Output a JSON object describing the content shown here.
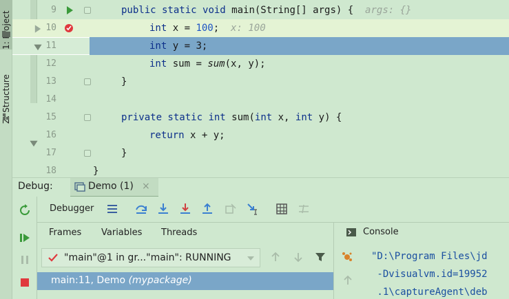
{
  "tool_strip": {
    "project_tab": "1: Project",
    "structure_tab": "Z: Structure"
  },
  "editor": {
    "lines": [
      {
        "num": "9",
        "code_parts": [
          "public",
          " static ",
          "void",
          " main(String[] args) {"
        ],
        "hint": "args: {}"
      },
      {
        "num": "10",
        "type_kw": "int",
        "rest": " x = ",
        "value": "100",
        "semicolon": ";",
        "hint": "x: 100"
      },
      {
        "num": "11",
        "type_kw": "int",
        "rest": " y = 3;"
      },
      {
        "num": "12",
        "type_kw": "int",
        "rest": " sum = ",
        "call": "sum",
        "args": "(x, y);"
      },
      {
        "num": "13",
        "code": "}"
      },
      {
        "num": "14",
        "code": ""
      },
      {
        "num": "15",
        "mods": "private static",
        "ret": "int",
        "name": " sum(",
        "p1t": "int",
        "p1": " x, ",
        "p2t": "int",
        "p2": " y) {"
      },
      {
        "num": "16",
        "kw": "return",
        "rest": " x + y;"
      },
      {
        "num": "17",
        "code": "}"
      },
      {
        "num": "18",
        "code": "}"
      }
    ]
  },
  "debug": {
    "title_label": "Debug:",
    "session_tab": "Demo (1)",
    "session_close": "×",
    "debugger_label": "Debugger",
    "tabs": [
      "Frames",
      "Variables",
      "Threads"
    ],
    "thread_selector": "\"main\"@1 in gr...\"main\": RUNNING",
    "frame": {
      "location": "main:11, Demo",
      "package": "(mypackage)"
    }
  },
  "console": {
    "tab_label": "Console",
    "output_lines": [
      "\"D:\\Program Files\\jd",
      " -Dvisualvm.id=19952",
      " .1\\captureAgent\\deb"
    ]
  },
  "colors": {
    "background": "#cfe8cf",
    "current_line": "#7aa6c8",
    "keyword": "#0c2f8a",
    "number": "#1d54c4",
    "breakpoint": "#e0393e"
  }
}
